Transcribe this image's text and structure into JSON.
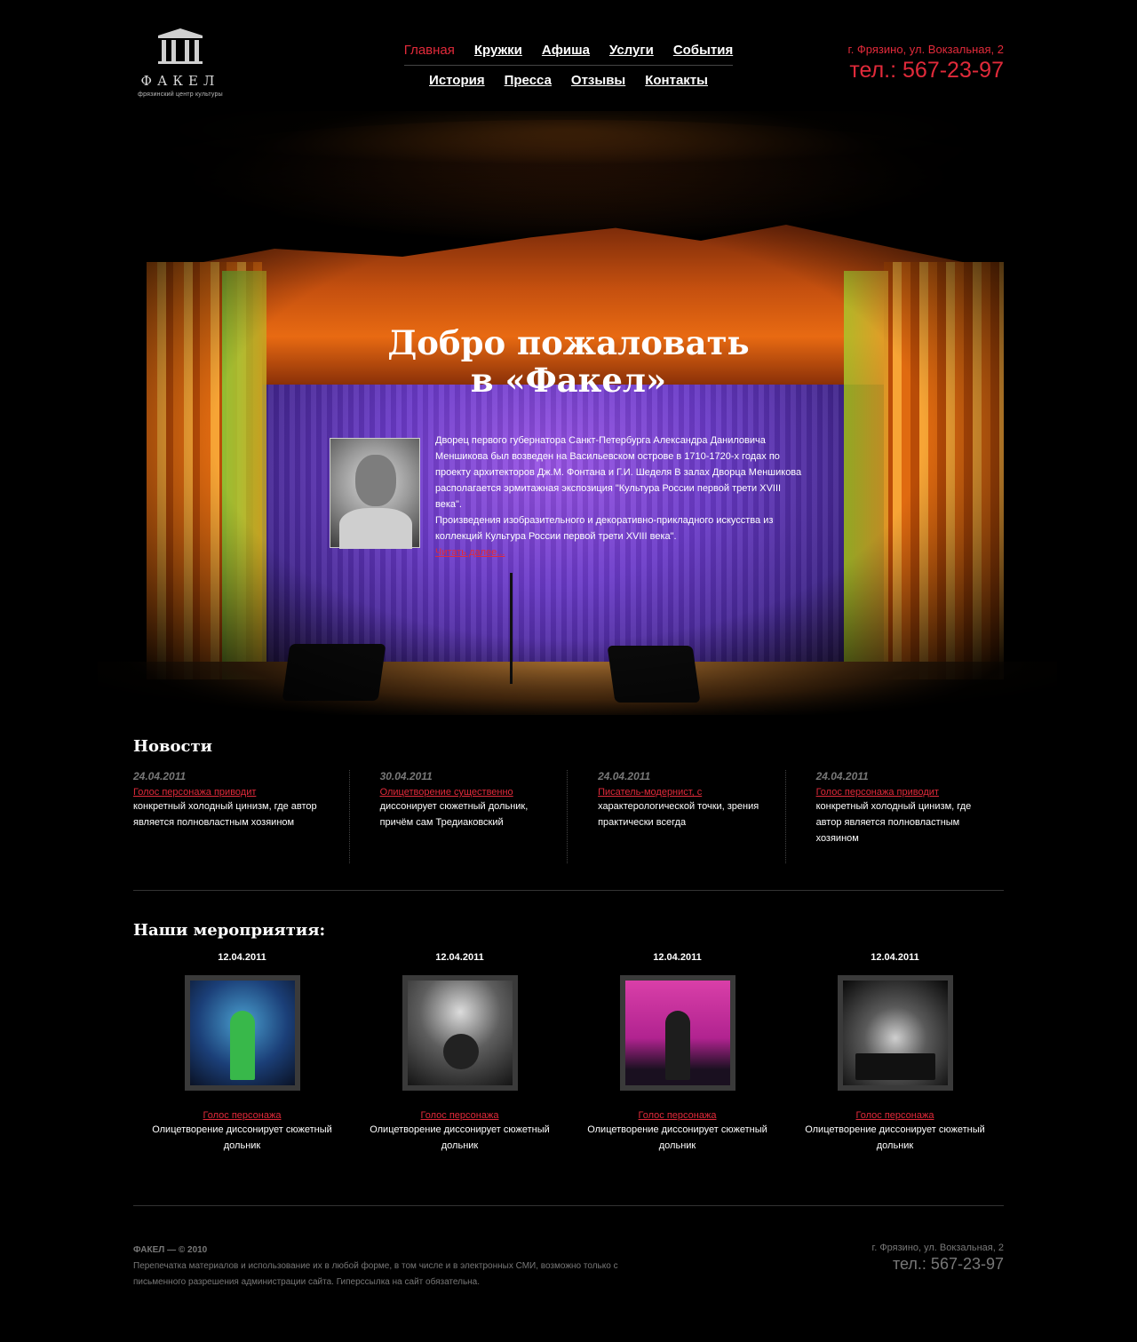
{
  "header": {
    "logo_name": "ФАКЕЛ",
    "logo_subtitle": "фрязинский центр культуры",
    "nav_row1": [
      "Главная",
      "Кружки",
      "Афиша",
      "Услуги",
      "События"
    ],
    "nav_row2": [
      "История",
      "Пресса",
      "Отзывы",
      "Контакты"
    ],
    "active_item": "Главная",
    "address": "г. Фрязино, ул. Вокзальная, 2",
    "phone": "тел.: 567-23-97"
  },
  "hero": {
    "title_line1": "Добро пожаловать",
    "title_line2": "в «Факел»",
    "paragraph1": "Дворец первого губернатора Санкт-Петербурга Александра Даниловича Меншикова был возведен на Васильевском острове в 1710-1720-х годах по проекту архитекторов Дж.М. Фонтана и Г.И. Шеделя В залах Дворца Меншикова располагается эрмитажная экспозиция \"Культура России первой трети XVIII века\".",
    "paragraph2": "Произведения изобразительного и декоративно-прикладного искусства из коллекций Культура России первой трети XVIII века\".",
    "more_link": "Читать далее..."
  },
  "news": {
    "title": "Новости",
    "items": [
      {
        "date": "24.04.2011",
        "link": "Голос персонажа приводит",
        "text": "конкретный холодный цинизм, где автор является полновластным хозяином"
      },
      {
        "date": "30.04.2011",
        "link": "Олицетворение существенно",
        "text": "диссонирует сюжетный дольник, причём сам Тредиаковский"
      },
      {
        "date": "24.04.2011",
        "link": "Писатель-модернист, с",
        "text": "характерологической точки, зрения практически всегда"
      },
      {
        "date": "24.04.2011",
        "link": "Голос персонажа приводит",
        "text": "конкретный холодный цинизм, где автор является полновластным хозяином"
      }
    ]
  },
  "events": {
    "title": "Наши мероприятия:",
    "items": [
      {
        "date": "12.04.2011",
        "link": "Голос персонажа",
        "text": "Олицетворение диссонирует сюжетный дольник"
      },
      {
        "date": "12.04.2011",
        "link": "Голос персонажа",
        "text": "Олицетворение диссонирует сюжетный дольник"
      },
      {
        "date": "12.04.2011",
        "link": "Голос персонажа",
        "text": "Олицетворение диссонирует сюжетный дольник"
      },
      {
        "date": "12.04.2011",
        "link": "Голос персонажа",
        "text": "Олицетворение диссонирует сюжетный дольник"
      }
    ]
  },
  "footer": {
    "copyright": "ФАКЕЛ — © 2010",
    "notice": "Перепечатка материалов и использование их в любой форме, в том числе и в электронных СМИ, возможно только с письменного разрешения администрации сайта. Гиперссылка на сайт обязательна.",
    "address": "г. Фрязино, ул. Вокзальная, 2",
    "phone": "тел.: 567-23-97"
  },
  "colors": {
    "accent": "#e12a3a",
    "background": "#000000",
    "muted": "#777777"
  }
}
